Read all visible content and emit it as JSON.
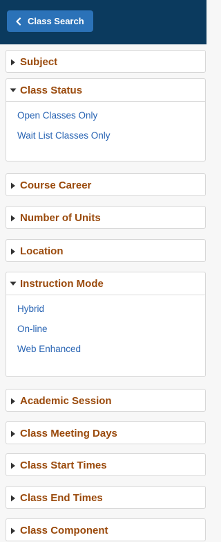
{
  "header": {
    "back_label": "Class Search"
  },
  "icons": {
    "back": "chevron-left-icon",
    "collapsed": "caret-right-icon",
    "expanded": "caret-down-icon"
  },
  "colors": {
    "topbar": "#0b3a5e",
    "back_button": "#2b72b8",
    "section_title": "#9a4a0c",
    "option_link": "#2763b3"
  },
  "sections": [
    {
      "label": "Subject",
      "expanded": false,
      "options": []
    },
    {
      "label": "Class Status",
      "expanded": true,
      "options": [
        "Open Classes Only",
        "Wait List Classes Only"
      ]
    },
    {
      "label": "Course Career",
      "expanded": false,
      "options": []
    },
    {
      "label": "Number of Units",
      "expanded": false,
      "options": []
    },
    {
      "label": "Location",
      "expanded": false,
      "options": []
    },
    {
      "label": "Instruction Mode",
      "expanded": true,
      "options": [
        "Hybrid",
        "On-line",
        "Web Enhanced"
      ]
    },
    {
      "label": "Academic Session",
      "expanded": false,
      "options": []
    },
    {
      "label": "Class Meeting Days",
      "expanded": false,
      "options": []
    },
    {
      "label": "Class Start Times",
      "expanded": false,
      "options": []
    },
    {
      "label": "Class End Times",
      "expanded": false,
      "options": []
    },
    {
      "label": "Class Component",
      "expanded": false,
      "options": []
    }
  ]
}
